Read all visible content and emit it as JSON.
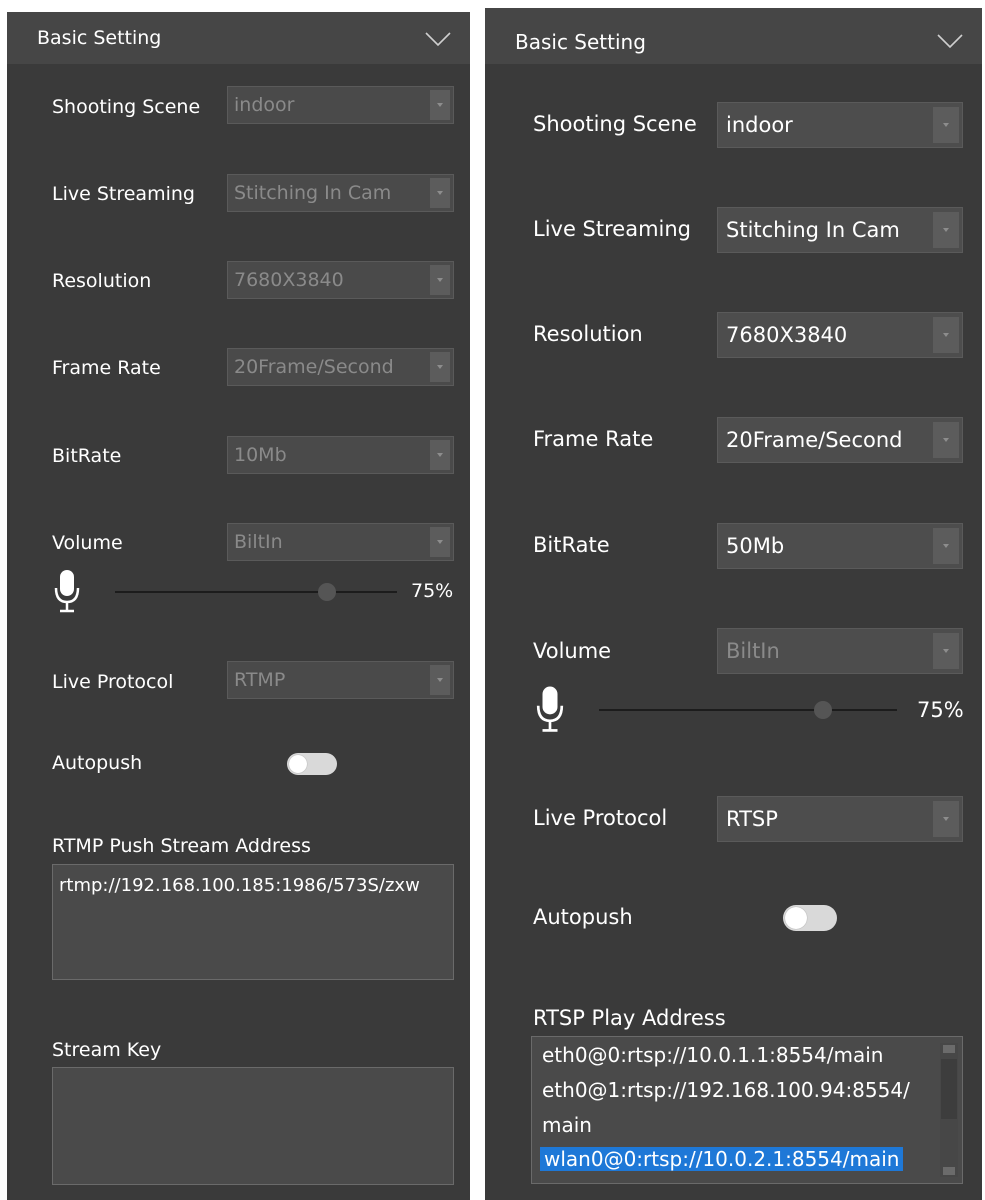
{
  "left_panel": {
    "header_title": "Basic Setting",
    "rows": [
      {
        "label": "Shooting Scene",
        "value": "indoor"
      },
      {
        "label": "Live Streaming",
        "value": "Stitching In Cam"
      },
      {
        "label": "Resolution",
        "value": "7680X3840"
      },
      {
        "label": "Frame Rate",
        "value": "20Frame/Second"
      },
      {
        "label": "BitRate",
        "value": "10Mb"
      },
      {
        "label": "Volume",
        "value": "BiltIn"
      }
    ],
    "volume_level": "75%",
    "volume_fraction": 0.75,
    "protocol": {
      "label": "Live Protocol",
      "value": "RTMP"
    },
    "autopush_label": "Autopush",
    "autopush_on": false,
    "push_address_label": "RTMP Push Stream Address",
    "push_address_value": "rtmp://192.168.100.185:1986/573S/zxw",
    "stream_key_label": "Stream Key",
    "stream_key_value": ""
  },
  "right_panel": {
    "header_title": "Basic Setting",
    "rows": [
      {
        "label": "Shooting Scene",
        "value": "indoor"
      },
      {
        "label": "Live Streaming",
        "value": "Stitching In Cam"
      },
      {
        "label": "Resolution",
        "value": "7680X3840"
      },
      {
        "label": "Frame Rate",
        "value": "20Frame/Second"
      },
      {
        "label": "BitRate",
        "value": "50Mb"
      },
      {
        "label": "Volume",
        "value": "BiltIn"
      }
    ],
    "volume_level": "75%",
    "volume_fraction": 0.75,
    "protocol": {
      "label": "Live Protocol",
      "value": "RTSP"
    },
    "autopush_label": "Autopush",
    "autopush_on": false,
    "play_address_label": "RTSP Play Address",
    "play_address_lines": [
      "eth0@0:rtsp://10.0.1.1:8554/main",
      "eth0@1:rtsp://192.168.100.94:8554/",
      "main",
      "wlan0@0:rtsp://10.0.2.1:8554/main"
    ],
    "selected_line_index": 3
  },
  "colors": {
    "panel_bg": "#3a3a3a",
    "header_bg": "#464646",
    "selection": "#1e78d7",
    "toggle_off": "#d9d9d9"
  },
  "icons": [
    "chevron-down-icon",
    "microphone-icon",
    "dropdown-arrow-icon"
  ]
}
